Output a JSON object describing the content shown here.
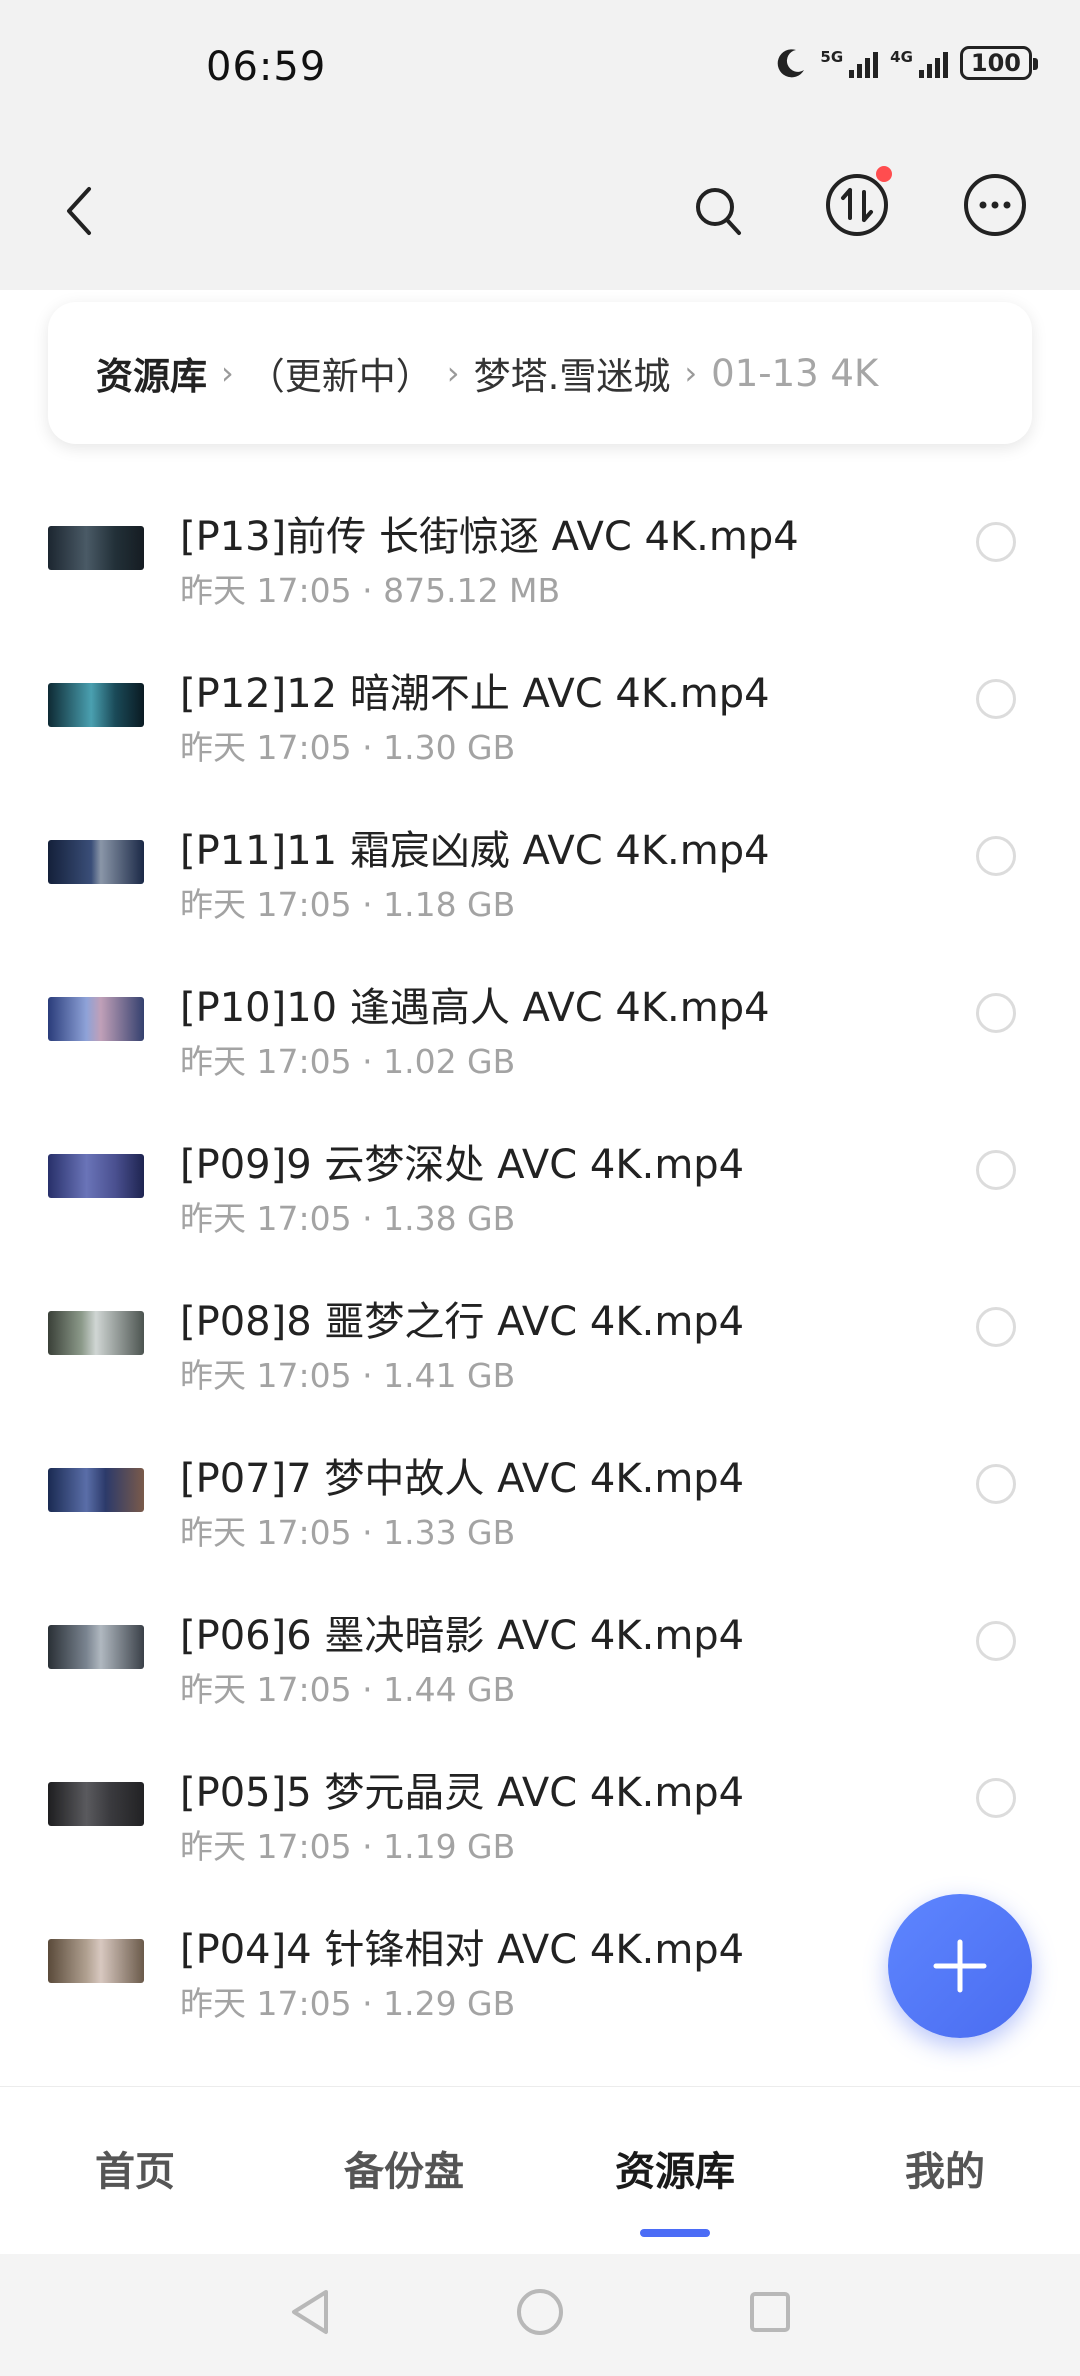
{
  "status": {
    "time": "06:59",
    "sig1_tag": "5G",
    "sig2_tag": "4G",
    "battery": "100"
  },
  "header": {
    "back": "back-icon",
    "search": "search-icon",
    "transfer": "transfer-icon",
    "more": "more-icon",
    "transfer_badge_color": "#ff4d4f"
  },
  "breadcrumb": {
    "root": "资源库",
    "level2": "（更新中）",
    "level3": "梦塔.雪迷城",
    "current": "01-13 4K"
  },
  "files": [
    {
      "name": "[P13]前传 长街惊逐 AVC 4K.mp4",
      "date": "昨天 17:05",
      "size": "875.12 MB"
    },
    {
      "name": "[P12]12 暗潮不止 AVC 4K.mp4",
      "date": "昨天 17:05",
      "size": "1.30 GB"
    },
    {
      "name": "[P11]11 霜宸凶威 AVC 4K.mp4",
      "date": "昨天 17:05",
      "size": "1.18 GB"
    },
    {
      "name": "[P10]10 逢遇高人 AVC 4K.mp4",
      "date": "昨天 17:05",
      "size": "1.02 GB"
    },
    {
      "name": "[P09]9 云梦深处 AVC 4K.mp4",
      "date": "昨天 17:05",
      "size": "1.38 GB"
    },
    {
      "name": "[P08]8 噩梦之行 AVC 4K.mp4",
      "date": "昨天 17:05",
      "size": "1.41 GB"
    },
    {
      "name": "[P07]7 梦中故人 AVC 4K.mp4",
      "date": "昨天 17:05",
      "size": "1.33 GB"
    },
    {
      "name": "[P06]6 墨决暗影 AVC 4K.mp4",
      "date": "昨天 17:05",
      "size": "1.44 GB"
    },
    {
      "name": "[P05]5 梦元晶灵 AVC 4K.mp4",
      "date": "昨天 17:05",
      "size": "1.19 GB"
    },
    {
      "name": "[P04]4 针锋相对 AVC 4K.mp4",
      "date": "昨天 17:05",
      "size": "1.29 GB"
    }
  ],
  "meta_separator": "·",
  "fab_icon": "plus-icon",
  "tabs": [
    {
      "label": "首页"
    },
    {
      "label": "备份盘"
    },
    {
      "label": "资源库"
    },
    {
      "label": "我的"
    }
  ],
  "colors": {
    "accent": "#4b6cf6",
    "fab": "#5576f5"
  }
}
